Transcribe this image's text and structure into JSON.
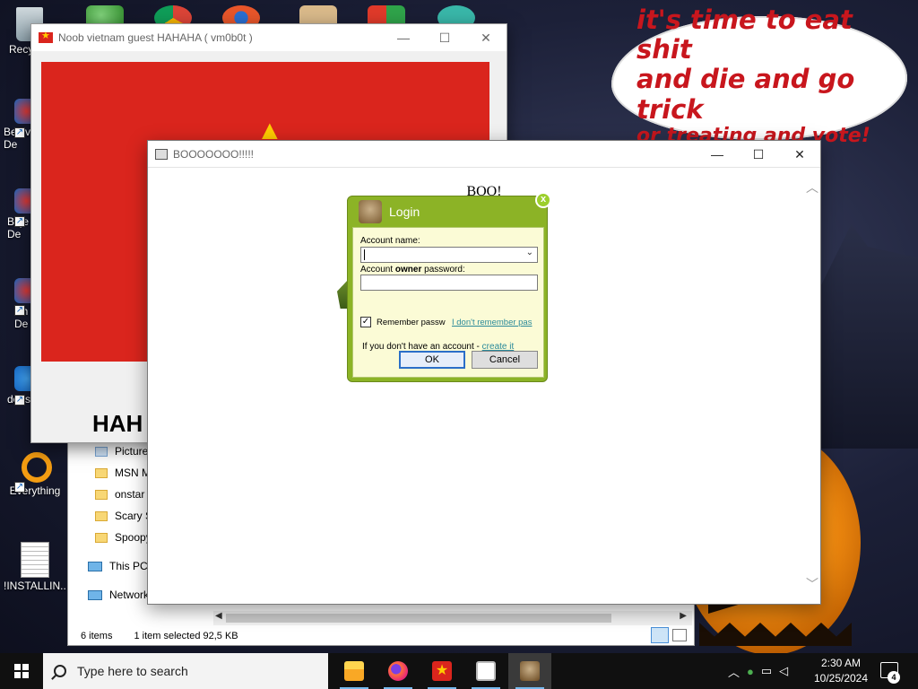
{
  "desktop": {
    "speech_bubble": {
      "line1": "it's time to eat shit",
      "line2": "and die and go trick",
      "line3": "or treating and vote!"
    },
    "icons": [
      {
        "label": "Recy",
        "icon": "recycle-bin-icon"
      },
      {
        "label": "Bejev De",
        "icon": "game-shortcut-icon"
      },
      {
        "label": "Beje De",
        "icon": "game-shortcut-icon"
      },
      {
        "label": "Ch De",
        "icon": "game-shortcut-icon"
      },
      {
        "label": "does",
        "icon": "game-shortcut-icon"
      },
      {
        "label": "Everything",
        "icon": "everything-search-icon"
      },
      {
        "label": "!INSTALLIN...",
        "icon": "text-file-icon"
      }
    ]
  },
  "noob_window": {
    "title": "Noob vietnam guest HAHAHA ( vm0b0t )",
    "caption_text": "HAH",
    "flag_red": "#da251d",
    "flag_yellow": "#ffcd00"
  },
  "explorer": {
    "nav_items": [
      {
        "label": "Picture",
        "icon": "pictures-folder-icon"
      },
      {
        "label": "MSN M",
        "icon": "folder-icon"
      },
      {
        "label": "onstar",
        "icon": "folder-icon"
      },
      {
        "label": "Scary S",
        "icon": "folder-icon"
      },
      {
        "label": "Spoopy",
        "icon": "folder-icon"
      }
    ],
    "this_pc": "This PC",
    "network": "Network",
    "status_items": "6 items",
    "status_selected": "1 item selected  92,5 KB"
  },
  "boo_window": {
    "title": "BOOOOOOO!!!!!",
    "body_text": "BOO!"
  },
  "login": {
    "title": "Login",
    "account_label": "Account name:",
    "password_label_pre": "Account ",
    "password_label_bold": "owner",
    "password_label_post": " password:",
    "account_value": "",
    "password_value": "",
    "remember_label": "Remember passw",
    "remember_checked": true,
    "forgot_link": "I don't remember pas",
    "no_account_text": "If you don't have an account - ",
    "create_link": "create it",
    "ok_label": "OK",
    "cancel_label": "Cancel",
    "accent": "#8cb326"
  },
  "taskbar": {
    "search_placeholder": "Type here to search",
    "apps": [
      {
        "name": "file-explorer",
        "icon": "folder-icon"
      },
      {
        "name": "firefox",
        "icon": "firefox-icon"
      },
      {
        "name": "vietnam-flag-app",
        "icon": "vietnam-flag-icon"
      },
      {
        "name": "window-app",
        "icon": "window-icon"
      },
      {
        "name": "dog-app",
        "icon": "dog-icon"
      }
    ],
    "time": "2:30 AM",
    "date": "10/25/2024",
    "notification_count": "4"
  }
}
